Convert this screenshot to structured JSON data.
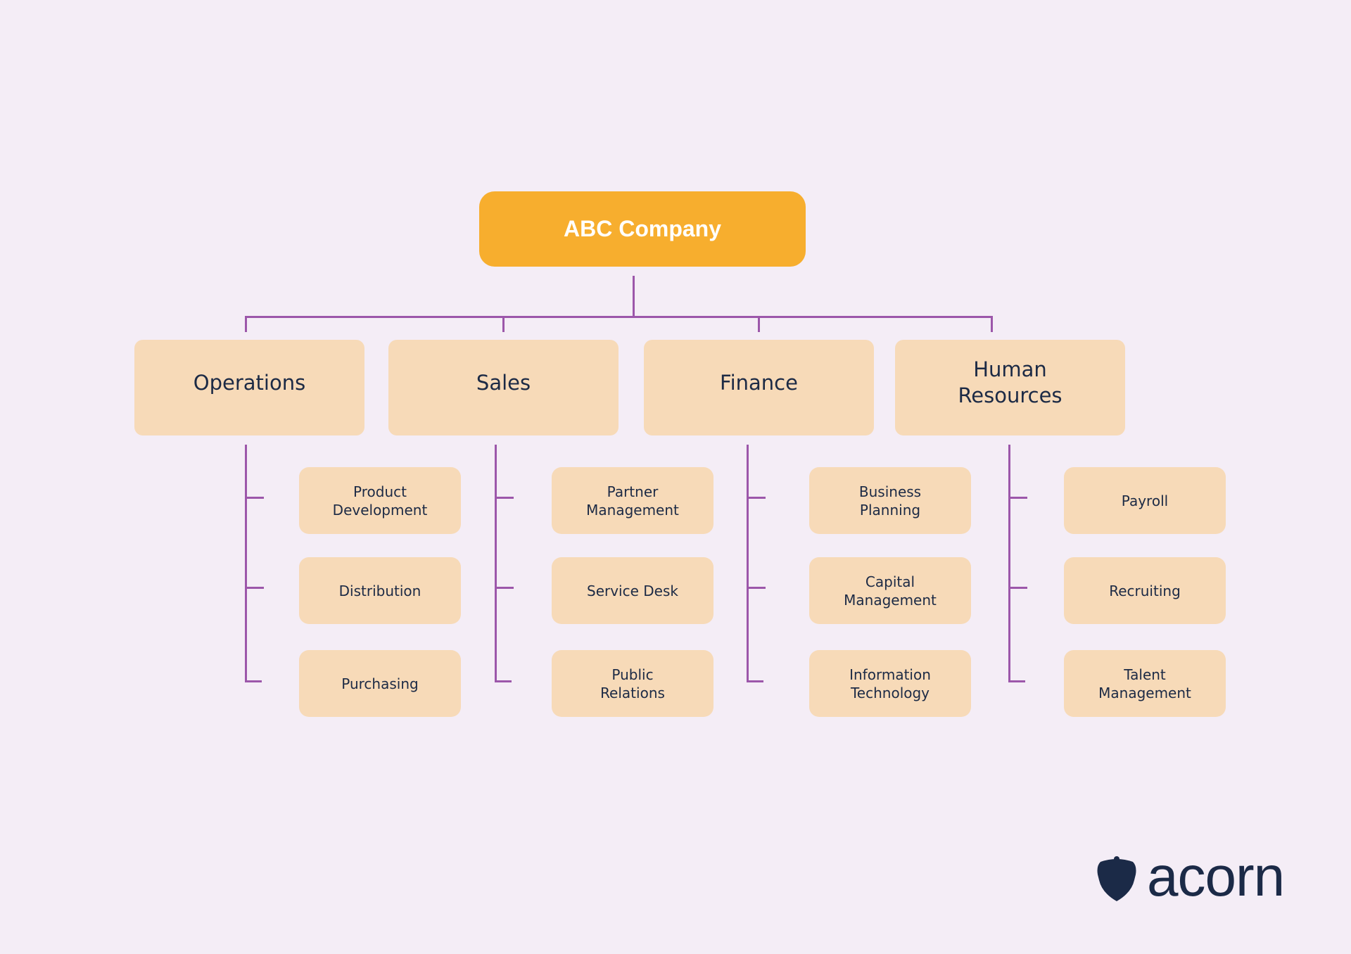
{
  "root": {
    "label": "ABC Company"
  },
  "departments": [
    {
      "label": "Operations",
      "children": [
        "Product\nDevelopment",
        "Distribution",
        "Purchasing"
      ]
    },
    {
      "label": "Sales",
      "children": [
        "Partner\nManagement",
        "Service Desk",
        "Public\nRelations"
      ]
    },
    {
      "label": "Finance",
      "children": [
        "Business\nPlanning",
        "Capital\nManagement",
        "Information\nTechnology"
      ]
    },
    {
      "label": "Human\nResources",
      "children": [
        "Payroll",
        "Recruiting",
        "Talent\nManagement"
      ]
    }
  ],
  "logo": {
    "text": "acorn",
    "icon": "acorn-icon"
  },
  "colors": {
    "background": "#F4EDF6",
    "root_box": "#F7AE2E",
    "node_box": "#F7DAB8",
    "connector": "#9C57AA",
    "text": "#1C2A45"
  }
}
